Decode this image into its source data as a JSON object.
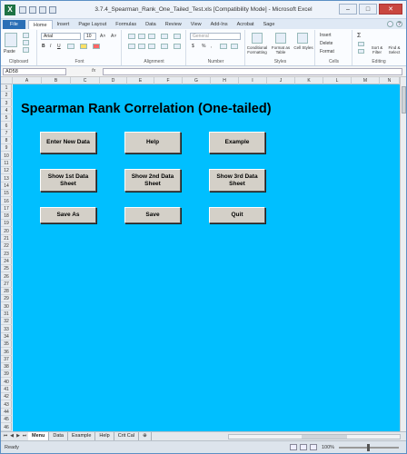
{
  "window": {
    "title": "3.7.4_Spearman_Rank_One_Tailed_Test.xls [Compatibility Mode] - Microsoft Excel",
    "logo": "X",
    "minimize": "–",
    "maximize": "□",
    "close": "✕"
  },
  "ribbon_tabs": [
    "File",
    "Home",
    "Insert",
    "Page Layout",
    "Formulas",
    "Data",
    "Review",
    "View",
    "Add-Ins",
    "Acrobat",
    "Sage"
  ],
  "ribbon": {
    "clipboard": {
      "paste": "Paste",
      "label": "Clipboard"
    },
    "font": {
      "name": "Arial",
      "size": "10",
      "bold": "B",
      "italic": "I",
      "underline": "U",
      "label": "Font"
    },
    "alignment": {
      "label": "Alignment"
    },
    "number": {
      "format": "General",
      "currency": "$",
      "percent": "%",
      "comma": ",",
      "label": "Number"
    },
    "styles": {
      "conditional": "Conditional Formatting",
      "format_table": "Format as Table",
      "cell_styles": "Cell Styles",
      "label": "Styles"
    },
    "cells": {
      "insert": "Insert",
      "delete": "Delete",
      "format": "Format",
      "label": "Cells"
    },
    "editing": {
      "sigma": "Σ",
      "sort": "Sort & Filter",
      "find": "Find & Select",
      "label": "Editing"
    }
  },
  "formula_bar": {
    "name_box": "AD58",
    "fx": "fx",
    "value": ""
  },
  "columns": [
    "A",
    "B",
    "C",
    "D",
    "E",
    "F",
    "G",
    "H",
    "I",
    "J",
    "K",
    "L",
    "M",
    "N"
  ],
  "rows": [
    "1",
    "2",
    "3",
    "4",
    "5",
    "6",
    "7",
    "8",
    "9",
    "10",
    "11",
    "12",
    "13",
    "14",
    "15",
    "16",
    "17",
    "18",
    "19",
    "20",
    "21",
    "22",
    "23",
    "24",
    "25",
    "26",
    "27",
    "28",
    "29",
    "30",
    "31",
    "32",
    "33",
    "34",
    "35",
    "36",
    "37",
    "38",
    "39",
    "40",
    "41",
    "42",
    "43",
    "44",
    "45",
    "46"
  ],
  "sheet": {
    "title": "Spearman Rank Correlation (One-tailed)",
    "background": "#00bfff",
    "buttons": {
      "enter_new_data": "Enter New Data",
      "help": "Help",
      "example": "Example",
      "show_1st": "Show 1st Data Sheet",
      "show_2nd": "Show 2nd Data Sheet",
      "show_3rd": "Show 3rd Data Sheet",
      "save_as": "Save As",
      "save": "Save",
      "quit": "Quit"
    }
  },
  "sheet_tabs": [
    "Menu",
    "Data",
    "Example",
    "Help",
    "Crit Cal"
  ],
  "active_sheet": "Menu",
  "status": {
    "ready": "Ready",
    "zoom": "100%"
  }
}
